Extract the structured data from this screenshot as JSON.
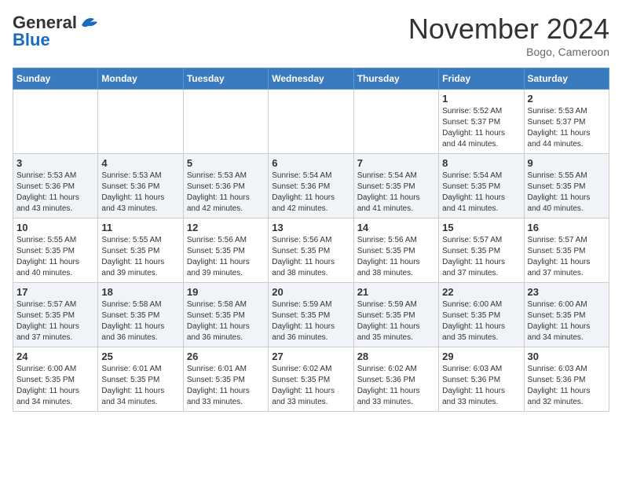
{
  "header": {
    "logo_general": "General",
    "logo_blue": "Blue",
    "month_title": "November 2024",
    "location": "Bogo, Cameroon"
  },
  "days_of_week": [
    "Sunday",
    "Monday",
    "Tuesday",
    "Wednesday",
    "Thursday",
    "Friday",
    "Saturday"
  ],
  "weeks": [
    [
      {
        "day": "",
        "info": ""
      },
      {
        "day": "",
        "info": ""
      },
      {
        "day": "",
        "info": ""
      },
      {
        "day": "",
        "info": ""
      },
      {
        "day": "",
        "info": ""
      },
      {
        "day": "1",
        "info": "Sunrise: 5:52 AM\nSunset: 5:37 PM\nDaylight: 11 hours\nand 44 minutes."
      },
      {
        "day": "2",
        "info": "Sunrise: 5:53 AM\nSunset: 5:37 PM\nDaylight: 11 hours\nand 44 minutes."
      }
    ],
    [
      {
        "day": "3",
        "info": "Sunrise: 5:53 AM\nSunset: 5:36 PM\nDaylight: 11 hours\nand 43 minutes."
      },
      {
        "day": "4",
        "info": "Sunrise: 5:53 AM\nSunset: 5:36 PM\nDaylight: 11 hours\nand 43 minutes."
      },
      {
        "day": "5",
        "info": "Sunrise: 5:53 AM\nSunset: 5:36 PM\nDaylight: 11 hours\nand 42 minutes."
      },
      {
        "day": "6",
        "info": "Sunrise: 5:54 AM\nSunset: 5:36 PM\nDaylight: 11 hours\nand 42 minutes."
      },
      {
        "day": "7",
        "info": "Sunrise: 5:54 AM\nSunset: 5:35 PM\nDaylight: 11 hours\nand 41 minutes."
      },
      {
        "day": "8",
        "info": "Sunrise: 5:54 AM\nSunset: 5:35 PM\nDaylight: 11 hours\nand 41 minutes."
      },
      {
        "day": "9",
        "info": "Sunrise: 5:55 AM\nSunset: 5:35 PM\nDaylight: 11 hours\nand 40 minutes."
      }
    ],
    [
      {
        "day": "10",
        "info": "Sunrise: 5:55 AM\nSunset: 5:35 PM\nDaylight: 11 hours\nand 40 minutes."
      },
      {
        "day": "11",
        "info": "Sunrise: 5:55 AM\nSunset: 5:35 PM\nDaylight: 11 hours\nand 39 minutes."
      },
      {
        "day": "12",
        "info": "Sunrise: 5:56 AM\nSunset: 5:35 PM\nDaylight: 11 hours\nand 39 minutes."
      },
      {
        "day": "13",
        "info": "Sunrise: 5:56 AM\nSunset: 5:35 PM\nDaylight: 11 hours\nand 38 minutes."
      },
      {
        "day": "14",
        "info": "Sunrise: 5:56 AM\nSunset: 5:35 PM\nDaylight: 11 hours\nand 38 minutes."
      },
      {
        "day": "15",
        "info": "Sunrise: 5:57 AM\nSunset: 5:35 PM\nDaylight: 11 hours\nand 37 minutes."
      },
      {
        "day": "16",
        "info": "Sunrise: 5:57 AM\nSunset: 5:35 PM\nDaylight: 11 hours\nand 37 minutes."
      }
    ],
    [
      {
        "day": "17",
        "info": "Sunrise: 5:57 AM\nSunset: 5:35 PM\nDaylight: 11 hours\nand 37 minutes."
      },
      {
        "day": "18",
        "info": "Sunrise: 5:58 AM\nSunset: 5:35 PM\nDaylight: 11 hours\nand 36 minutes."
      },
      {
        "day": "19",
        "info": "Sunrise: 5:58 AM\nSunset: 5:35 PM\nDaylight: 11 hours\nand 36 minutes."
      },
      {
        "day": "20",
        "info": "Sunrise: 5:59 AM\nSunset: 5:35 PM\nDaylight: 11 hours\nand 36 minutes."
      },
      {
        "day": "21",
        "info": "Sunrise: 5:59 AM\nSunset: 5:35 PM\nDaylight: 11 hours\nand 35 minutes."
      },
      {
        "day": "22",
        "info": "Sunrise: 6:00 AM\nSunset: 5:35 PM\nDaylight: 11 hours\nand 35 minutes."
      },
      {
        "day": "23",
        "info": "Sunrise: 6:00 AM\nSunset: 5:35 PM\nDaylight: 11 hours\nand 34 minutes."
      }
    ],
    [
      {
        "day": "24",
        "info": "Sunrise: 6:00 AM\nSunset: 5:35 PM\nDaylight: 11 hours\nand 34 minutes."
      },
      {
        "day": "25",
        "info": "Sunrise: 6:01 AM\nSunset: 5:35 PM\nDaylight: 11 hours\nand 34 minutes."
      },
      {
        "day": "26",
        "info": "Sunrise: 6:01 AM\nSunset: 5:35 PM\nDaylight: 11 hours\nand 33 minutes."
      },
      {
        "day": "27",
        "info": "Sunrise: 6:02 AM\nSunset: 5:35 PM\nDaylight: 11 hours\nand 33 minutes."
      },
      {
        "day": "28",
        "info": "Sunrise: 6:02 AM\nSunset: 5:36 PM\nDaylight: 11 hours\nand 33 minutes."
      },
      {
        "day": "29",
        "info": "Sunrise: 6:03 AM\nSunset: 5:36 PM\nDaylight: 11 hours\nand 33 minutes."
      },
      {
        "day": "30",
        "info": "Sunrise: 6:03 AM\nSunset: 5:36 PM\nDaylight: 11 hours\nand 32 minutes."
      }
    ]
  ]
}
